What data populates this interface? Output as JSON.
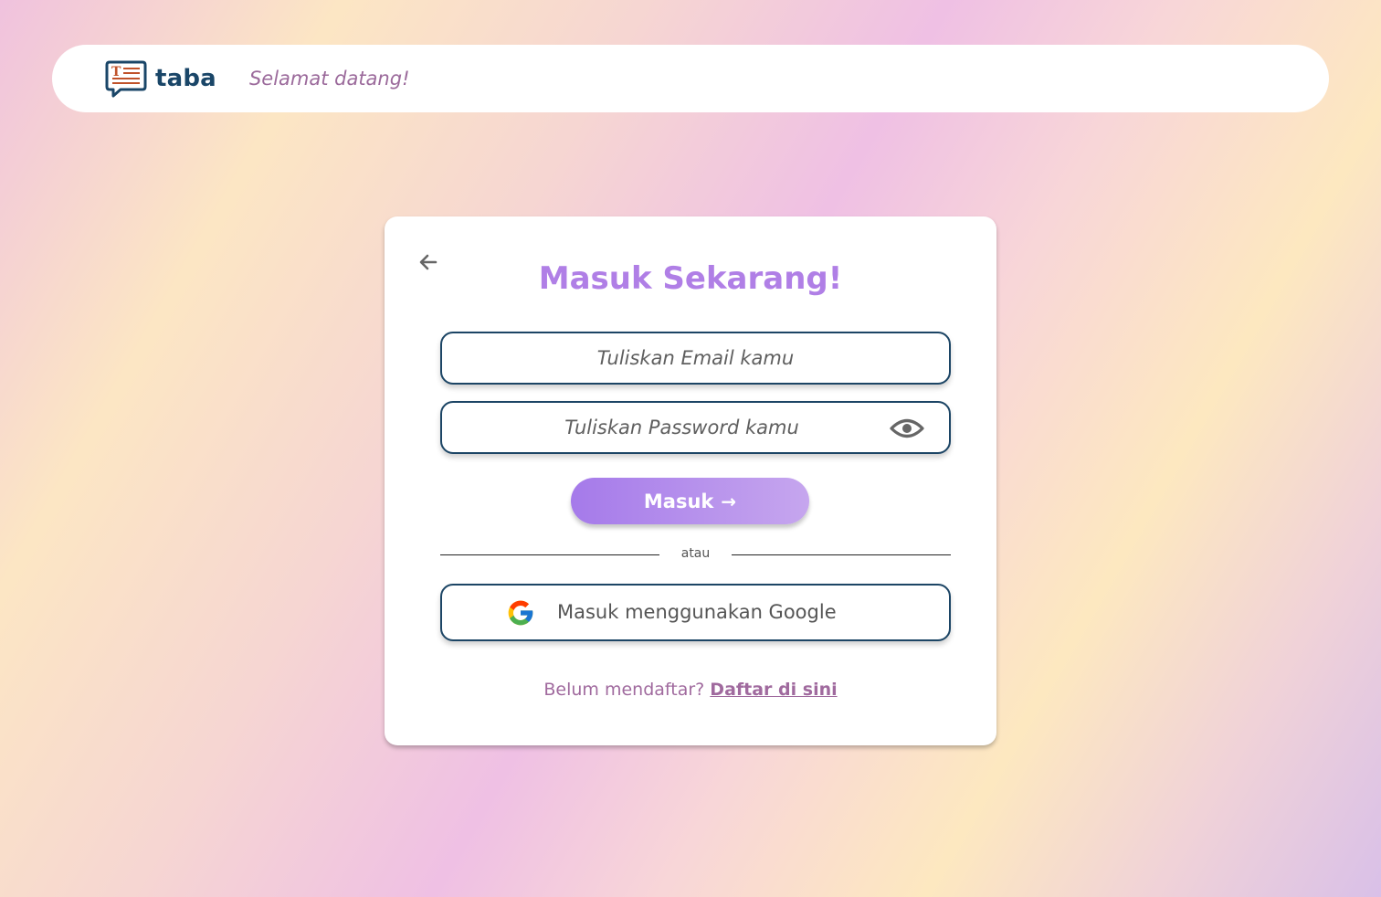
{
  "header": {
    "brand": "taba",
    "logo_letter": "T",
    "welcome": "Selamat datang!"
  },
  "login": {
    "title": "Masuk Sekarang!",
    "email_placeholder": "Tuliskan Email kamu",
    "password_placeholder": "Tuliskan Password kamu",
    "submit_label": "Masuk",
    "submit_arrow": "→",
    "divider_text": "atau",
    "google_label": "Masuk menggunakan Google",
    "footer_prompt": "Belum mendaftar?",
    "footer_link": "Daftar di sini"
  },
  "icons": {
    "back": "arrow-left-icon",
    "eye": "eye-icon",
    "google": "google-icon",
    "logo": "chat-document-icon"
  },
  "colors": {
    "accent": "#b07fe6",
    "brand": "#1a4668",
    "muted_pink": "#a06a9e",
    "border": "#1c4565"
  }
}
